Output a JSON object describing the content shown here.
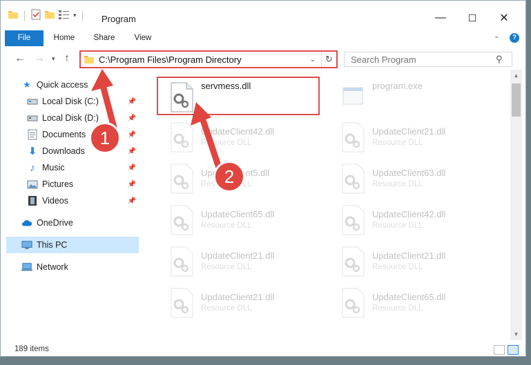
{
  "window": {
    "title": "Program",
    "controls": {
      "minimize": "—",
      "maximize": "☐",
      "close": "✕"
    }
  },
  "ribbon": {
    "tabs": [
      {
        "label": "File"
      },
      {
        "label": "Home"
      },
      {
        "label": "Share"
      },
      {
        "label": "View"
      }
    ]
  },
  "address": {
    "path": "C:\\Program Files\\Program Directory",
    "search_placeholder": "Search Program"
  },
  "sidebar": {
    "items": [
      {
        "label": "Quick access"
      },
      {
        "label": "Local Disk (C:)"
      },
      {
        "label": "Local Disk (D:)"
      },
      {
        "label": "Documents"
      },
      {
        "label": "Downloads"
      },
      {
        "label": "Music"
      },
      {
        "label": "Pictures"
      },
      {
        "label": "Videos"
      },
      {
        "label": "OneDrive"
      },
      {
        "label": "This PC"
      },
      {
        "label": "Network"
      }
    ]
  },
  "files": [
    {
      "name": "servmess.dll",
      "type": ""
    },
    {
      "name": "program.exe",
      "type": ""
    },
    {
      "name": "UpdateClient42.dll",
      "type": "Resource DLL"
    },
    {
      "name": "UpdateClient21.dll",
      "type": "Resource DLL"
    },
    {
      "name": "UpdateClient5.dll",
      "type": "Resource DLL"
    },
    {
      "name": "UpdateClient63.dll",
      "type": "Resource DLL"
    },
    {
      "name": "UpdateClient65.dll",
      "type": "Resource DLL"
    },
    {
      "name": "UpdateClient42.dll",
      "type": "Resource DLL"
    },
    {
      "name": "UpdateClient21.dll",
      "type": "Resource DLL"
    },
    {
      "name": "UpdateClient21.dll",
      "type": "Resource DLL"
    },
    {
      "name": "UpdateClient21.dll",
      "type": "Resource DLL"
    },
    {
      "name": "UpdateClient65.dll",
      "type": "Resource DLL"
    }
  ],
  "status": {
    "count": "189 items"
  },
  "annotations": {
    "step1": "1",
    "step2": "2"
  },
  "colors": {
    "accent": "#1979ca",
    "highlight": "#e04a4a",
    "selected": "#cce8ff"
  }
}
